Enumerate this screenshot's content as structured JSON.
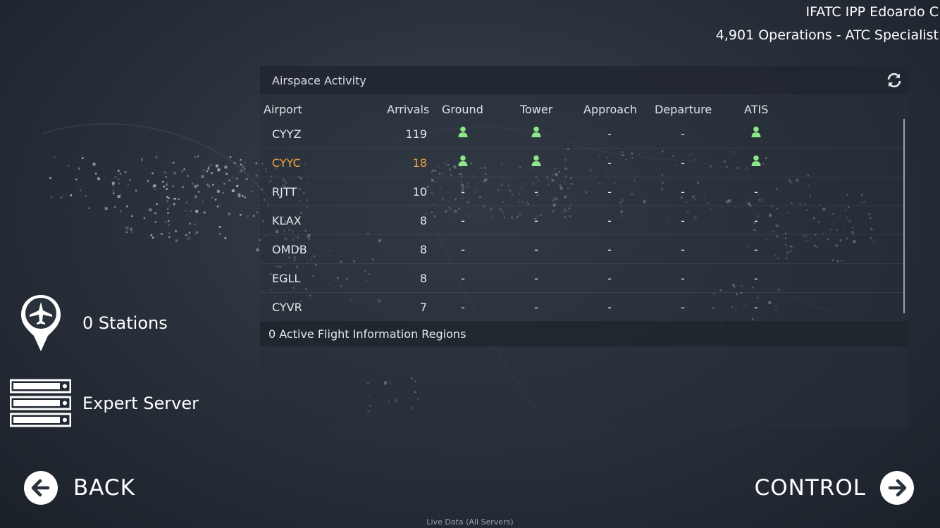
{
  "user": {
    "name": "IFATC IPP Edoardo C",
    "stats": "4,901 Operations - ATC Specialist"
  },
  "panel": {
    "title": "Airspace Activity",
    "columns": {
      "airport": "Airport",
      "arrivals": "Arrivals",
      "ground": "Ground",
      "tower": "Tower",
      "approach": "Approach",
      "departure": "Departure",
      "atis": "ATIS"
    },
    "rows": [
      {
        "code": "CYYZ",
        "arrivals": "119",
        "ground": "person",
        "tower": "person",
        "approach": "-",
        "departure": "-",
        "atis": "person",
        "highlight": false
      },
      {
        "code": "CYYC",
        "arrivals": "18",
        "ground": "person",
        "tower": "person",
        "approach": "-",
        "departure": "-",
        "atis": "person",
        "highlight": true
      },
      {
        "code": "RJTT",
        "arrivals": "10",
        "ground": "-",
        "tower": "-",
        "approach": "-",
        "departure": "-",
        "atis": "-",
        "highlight": false
      },
      {
        "code": "KLAX",
        "arrivals": "8",
        "ground": "-",
        "tower": "-",
        "approach": "-",
        "departure": "-",
        "atis": "-",
        "highlight": false
      },
      {
        "code": "OMDB",
        "arrivals": "8",
        "ground": "-",
        "tower": "-",
        "approach": "-",
        "departure": "-",
        "atis": "-",
        "highlight": false
      },
      {
        "code": "EGLL",
        "arrivals": "8",
        "ground": "-",
        "tower": "-",
        "approach": "-",
        "departure": "-",
        "atis": "-",
        "highlight": false
      },
      {
        "code": "CYVR",
        "arrivals": "7",
        "ground": "-",
        "tower": "-",
        "approach": "-",
        "departure": "-",
        "atis": "-",
        "highlight": false
      }
    ],
    "fir_text": "0 Active Flight Information Regions"
  },
  "left": {
    "stations_label": "0 Stations",
    "server_label": "Expert Server"
  },
  "nav": {
    "back_label": "BACK",
    "control_label": "CONTROL"
  },
  "footer": "Live Data (All Servers)",
  "colors": {
    "controller_active": "#8ee68a",
    "highlight": "#f0a040"
  },
  "icons": {
    "refresh": "refresh-icon",
    "controller": "person-icon",
    "stations": "map-pin-airplane-icon",
    "server": "server-icon",
    "back": "arrow-left-circle-icon",
    "control": "arrow-right-circle-icon"
  }
}
